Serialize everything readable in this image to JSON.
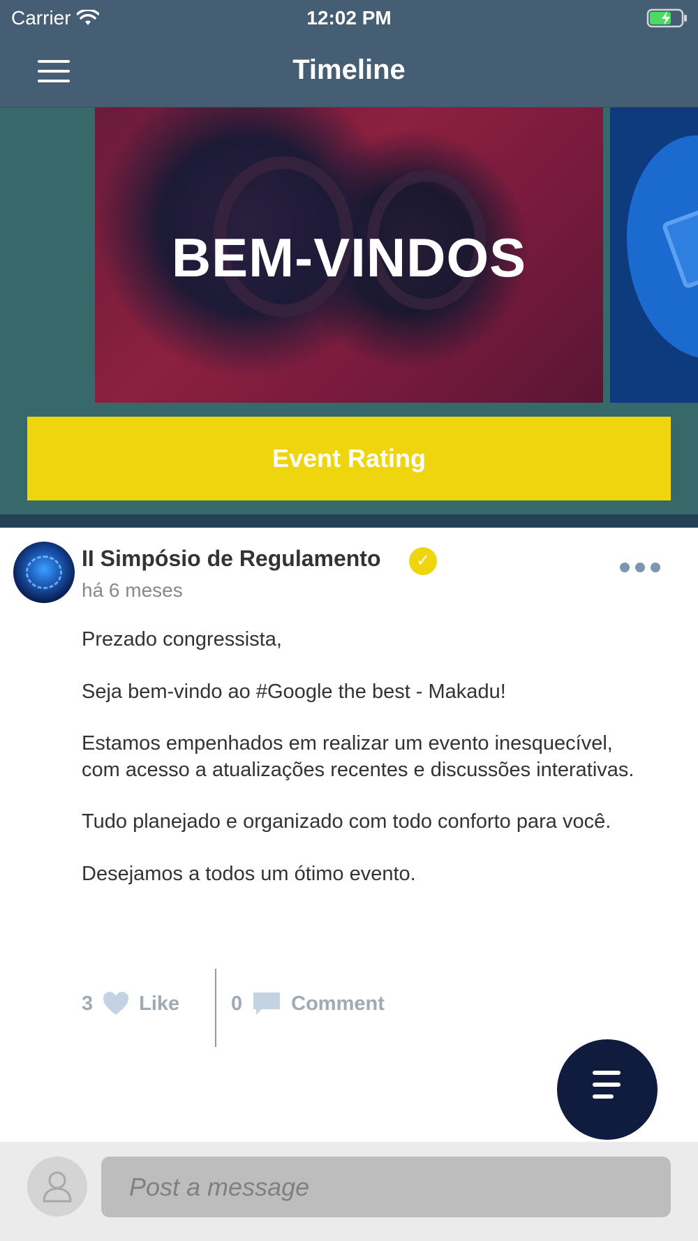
{
  "status_bar": {
    "carrier": "Carrier",
    "time": "12:02 PM"
  },
  "nav": {
    "title": "Timeline"
  },
  "banner": {
    "headline": "BEM-VINDOS"
  },
  "event_rating_button": {
    "label": "Event Rating"
  },
  "post": {
    "author": "II Simpósio de Regulamento",
    "time_ago": "há 6 meses",
    "paragraphs": [
      "Prezado congressista,",
      "Seja bem-vindo ao #Google the best - Makadu!",
      "Estamos empenhados em realizar um evento inesquecível, com acesso a atualizações recentes e discussões interativas.",
      "Tudo planejado e organizado com todo conforto para você.",
      "Desejamos a todos um ótimo evento."
    ],
    "likes_count": "3",
    "like_label": "Like",
    "comments_count": "0",
    "comment_label": "Comment"
  },
  "composer": {
    "placeholder": "Post a message"
  },
  "colors": {
    "nav_bg": "#455e73",
    "banner_bg": "#37696a",
    "accent_yellow": "#efd50d",
    "fab_bg": "#0f1c3d"
  },
  "icons": {
    "menu": "hamburger-icon",
    "wifi": "wifi-icon",
    "battery": "battery-charging-icon",
    "verified": "verified-check-icon",
    "more": "more-dots-icon",
    "like": "heart-icon",
    "comment": "comment-bubble-icon",
    "fab": "filter-lines-icon",
    "user": "user-icon"
  }
}
